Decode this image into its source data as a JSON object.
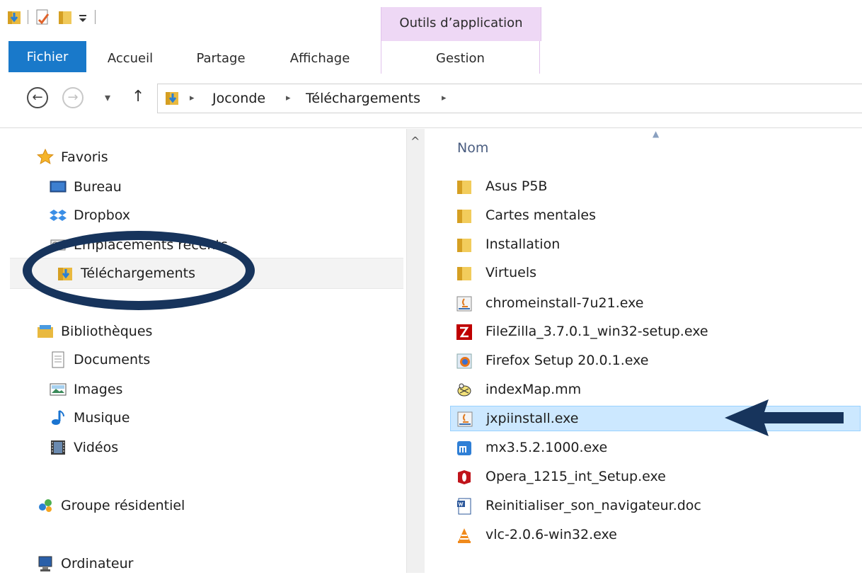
{
  "window": {
    "context_tab_label": "Outils d’application"
  },
  "ribbon": {
    "tabs": [
      {
        "label": "Fichier"
      },
      {
        "label": "Accueil"
      },
      {
        "label": "Partage"
      },
      {
        "label": "Affichage"
      },
      {
        "label": "Gestion"
      }
    ]
  },
  "address": {
    "back_glyph": "←",
    "forward_glyph": "→",
    "up_glyph": "↑",
    "dropdown_glyph": "▾",
    "separator_glyph": "▸",
    "breadcrumbs": [
      "Joconde",
      "Téléchargements"
    ]
  },
  "navigation": {
    "scroll_up_glyph": "^",
    "items": [
      {
        "label": "Favoris",
        "icon": "star-icon"
      },
      {
        "label": "Bureau",
        "icon": "desktop-icon"
      },
      {
        "label": "Dropbox",
        "icon": "dropbox-icon"
      },
      {
        "label": "Emplacements récents",
        "icon": "recent-places-icon"
      },
      {
        "label": "Téléchargements",
        "icon": "downloads-folder-icon"
      },
      {
        "label": "Bibliothèques",
        "icon": "libraries-icon"
      },
      {
        "label": "Documents",
        "icon": "documents-icon"
      },
      {
        "label": "Images",
        "icon": "images-icon"
      },
      {
        "label": "Musique",
        "icon": "music-icon"
      },
      {
        "label": "Vidéos",
        "icon": "videos-icon"
      },
      {
        "label": "Groupe résidentiel",
        "icon": "homegroup-icon"
      },
      {
        "label": "Ordinateur",
        "icon": "computer-icon"
      }
    ]
  },
  "filelist": {
    "column_name": "Nom",
    "sort_glyph": "▲",
    "files": [
      {
        "name": "Asus P5B",
        "icon": "folder-icon"
      },
      {
        "name": "Cartes mentales",
        "icon": "folder-icon"
      },
      {
        "name": "Installation",
        "icon": "folder-icon"
      },
      {
        "name": "Virtuels",
        "icon": "folder-icon"
      },
      {
        "name": "chromeinstall-7u21.exe",
        "icon": "java-installer-icon"
      },
      {
        "name": "FileZilla_3.7.0.1_win32-setup.exe",
        "icon": "filezilla-icon"
      },
      {
        "name": "Firefox Setup 20.0.1.exe",
        "icon": "firefox-setup-icon"
      },
      {
        "name": "indexMap.mm",
        "icon": "freemind-icon"
      },
      {
        "name": "jxpiinstall.exe",
        "icon": "java-installer-icon",
        "selected": true
      },
      {
        "name": "mx3.5.2.1000.exe",
        "icon": "maxthon-icon"
      },
      {
        "name": "Opera_1215_int_Setup.exe",
        "icon": "opera-icon"
      },
      {
        "name": "Reinitialiser_son_navigateur.doc",
        "icon": "word-doc-icon"
      },
      {
        "name": "vlc-2.0.6-win32.exe",
        "icon": "vlc-icon"
      }
    ]
  },
  "colors": {
    "accent": "#1979ca",
    "context_tab": "#eed8f5",
    "selection": "#cce8ff",
    "annotation": "#17345c"
  }
}
